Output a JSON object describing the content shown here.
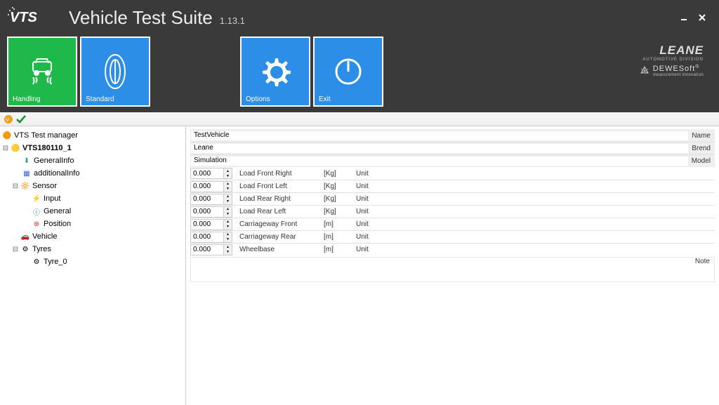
{
  "app": {
    "title": "Vehicle Test Suite",
    "version": "1.13.1"
  },
  "tiles": {
    "handling": "Handling",
    "standard": "Standard",
    "options": "Options",
    "exit": "Exit"
  },
  "brands": {
    "leane": "LEANE",
    "leane_sub": "AUTOMOTIVE DIVISION",
    "dewesoft": "DEWESoft",
    "dewesoft_sub": "measurement innovation"
  },
  "tree": {
    "root": "VTS Test manager",
    "n1": "VTS180110_1",
    "n1a": "GeneralInfo",
    "n1b": "additionalInfo",
    "n2": "Sensor",
    "n2a": "Input",
    "n2b": "General",
    "n2c": "Position",
    "n3": "Vehicle",
    "n4": "Tyres",
    "n4a": "Tyre_0"
  },
  "form": {
    "name_label": "Name",
    "name_value": "TestVehicle",
    "brand_label": "Brend",
    "brand_value": "Leane",
    "model_label": "Model",
    "model_value": "Simulation",
    "unit_text": "Unit",
    "rows": [
      {
        "value": "0.000",
        "label": "Load Front Right",
        "unit": "[Kg]"
      },
      {
        "value": "0.000",
        "label": "Load Front Left",
        "unit": "[Kg]"
      },
      {
        "value": "0.000",
        "label": "Load Rear Right",
        "unit": "[Kg]"
      },
      {
        "value": "0.000",
        "label": "Load Rear Left",
        "unit": "[Kg]"
      },
      {
        "value": "0.000",
        "label": "Carriageway Front",
        "unit": "[m]"
      },
      {
        "value": "0.000",
        "label": "Carriageway Rear",
        "unit": "[m]"
      },
      {
        "value": "0.000",
        "label": "Wheelbase",
        "unit": "[m]"
      }
    ],
    "note_label": "Note",
    "note_value": ""
  }
}
